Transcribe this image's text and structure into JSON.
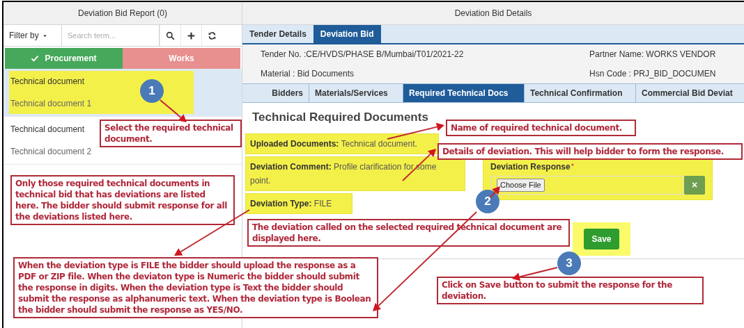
{
  "left_panel": {
    "title": "Deviation Bid Report (0)",
    "filter_label": "Filter by",
    "search": {
      "placeholder": "Search term..."
    },
    "toggles": [
      {
        "label": "Procurement",
        "selected": true
      },
      {
        "label": "Works",
        "selected": false
      }
    ],
    "items": [
      {
        "title": "Technical document",
        "subtitle": "Technical document 1",
        "selected": true
      },
      {
        "title": "Technical document",
        "subtitle": "Technical document 2",
        "selected": false
      }
    ]
  },
  "right_panel": {
    "title": "Deviation Bid Details",
    "tabs": [
      {
        "label": "Tender Details",
        "selected": false
      },
      {
        "label": "Deviation Bid",
        "selected": true
      }
    ],
    "info": [
      {
        "left": "Tender No. :CE/HVDS/PHASE B/Mumbai/T01/2021-22",
        "right": "Partner Name: WORKS VENDOR"
      },
      {
        "left": "Material : Bid Documents",
        "right": "Hsn Code : PRJ_BID_DOCUMEN"
      }
    ],
    "sub_tabs": [
      {
        "label": "Bidders",
        "selected": false
      },
      {
        "label": "Materials/Services",
        "selected": false
      },
      {
        "label": "Required Technical Docs",
        "selected": true
      },
      {
        "label": "Technical Confirmation",
        "selected": false
      },
      {
        "label": "Commercial Bid Deviat",
        "selected": false
      }
    ],
    "heading": "Technical Required Documents",
    "fields": [
      {
        "label": "Uploaded Documents:",
        "value": "Technical document."
      },
      {
        "label": "Deviation Comment:",
        "value": "Profile clarification for some point."
      },
      {
        "label": "Deviation Type:",
        "value": "FILE"
      }
    ],
    "response": {
      "label": "Deviation Response",
      "required_mark": "*",
      "file_button": "Choose File",
      "clear_button": "×"
    },
    "save_button": "Save"
  },
  "callouts": [
    "1",
    "2",
    "3"
  ],
  "annotations": [
    "Select the required technical document.",
    "Only those required technical documents in technical bid that has deviations are listed here. The bidder should submit response for all the deviations listed here.",
    "Name of required technical document.",
    "Details of deviation. This will help bidder to form the response.",
    "The deviation called on the selected required technical document are displayed here.",
    "When the deviation type is FILE the bidder should upload the response as a PDF or ZIP file. When the deviaton type is Numeric the bidder should submit the response in digits. When the deviation type is Text the bidder should submit the response as alphanumeric text. When the deviation type is Boolean the bidder should submit the response as YES/NO.",
    "Click on Save button to submit the response for the deviation."
  ]
}
